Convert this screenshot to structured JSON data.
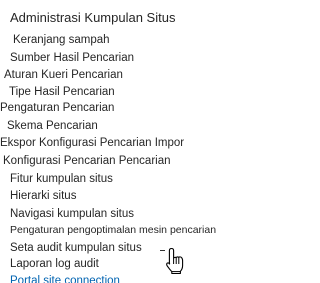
{
  "section": {
    "heading": "Administrasi Kumpulan Situs",
    "items": [
      {
        "label": "Keranjang sampah"
      },
      {
        "label": "Sumber Hasil Pencarian"
      },
      {
        "label": "Aturan Kueri Pencarian"
      },
      {
        "label": "Tipe Hasil Pencarian"
      },
      {
        "label": "Pengaturan Pencarian"
      },
      {
        "label": "Skema Pencarian"
      },
      {
        "label": "Ekspor Konfigurasi Pencarian Impor"
      },
      {
        "label": "Konfigurasi Pencarian Pencarian"
      },
      {
        "label": "Fitur kumpulan situs"
      },
      {
        "label": "Hierarki situs"
      },
      {
        "label": "Navigasi kumpulan situs"
      },
      {
        "label": "Pengaturan pengoptimalan mesin pencarian"
      },
      {
        "label": "Seta audit kumpulan situs"
      },
      {
        "label": "Laporan log audit"
      },
      {
        "label": "Portal site connection"
      }
    ]
  },
  "colors": {
    "text": "#262626",
    "link_accent": "#0063b1",
    "background": "#ffffff"
  },
  "cursor": {
    "icon": "hand-pointer-icon"
  }
}
